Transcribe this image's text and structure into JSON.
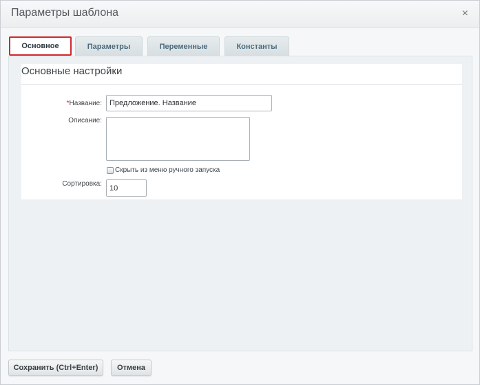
{
  "dialog": {
    "title": "Параметры шаблона",
    "close_label": "×"
  },
  "tabs": [
    {
      "label": "Основное",
      "active": true
    },
    {
      "label": "Параметры",
      "active": false
    },
    {
      "label": "Переменные",
      "active": false
    },
    {
      "label": "Константы",
      "active": false
    }
  ],
  "section": {
    "title": "Основные настройки"
  },
  "form": {
    "name_required_mark": "*",
    "name_label": "Название:",
    "name_value": "Предложение. Название",
    "description_label": "Описание:",
    "description_value": "",
    "hide_checkbox_label": "Скрыть из меню ручного запуска",
    "hide_checked": false,
    "sort_label": "Сортировка:",
    "sort_value": "10"
  },
  "footer": {
    "save_label": "Сохранить (Ctrl+Enter)",
    "cancel_label": "Отмена"
  },
  "colors": {
    "active_tab_border": "#d0272d",
    "required_mark": "#d0272d"
  }
}
